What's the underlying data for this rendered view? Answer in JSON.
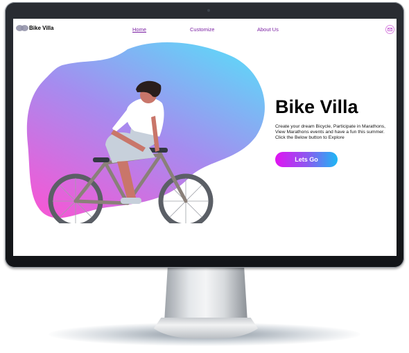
{
  "site": {
    "brand": "Bike Villa",
    "nav": [
      "Home",
      "Customize",
      "About Us"
    ],
    "active_nav": "Home"
  },
  "hero": {
    "title": "Bike Villa",
    "description": "Create your dream Bicycle, Participate in Marathons, View Marathons events and have a fun this summer. Click the Below button to Explore",
    "cta_label": "Lets Go"
  },
  "icons": {
    "mail": "mail-icon",
    "logo": "logo-icon",
    "illustration": "cyclist-illustration"
  },
  "colors": {
    "nav_link": "#7a1fa2",
    "blob_top": "#5fd7f8",
    "blob_bottom": "#f15ad6",
    "cta_start": "#e113f1",
    "cta_end": "#1cb8f4"
  }
}
